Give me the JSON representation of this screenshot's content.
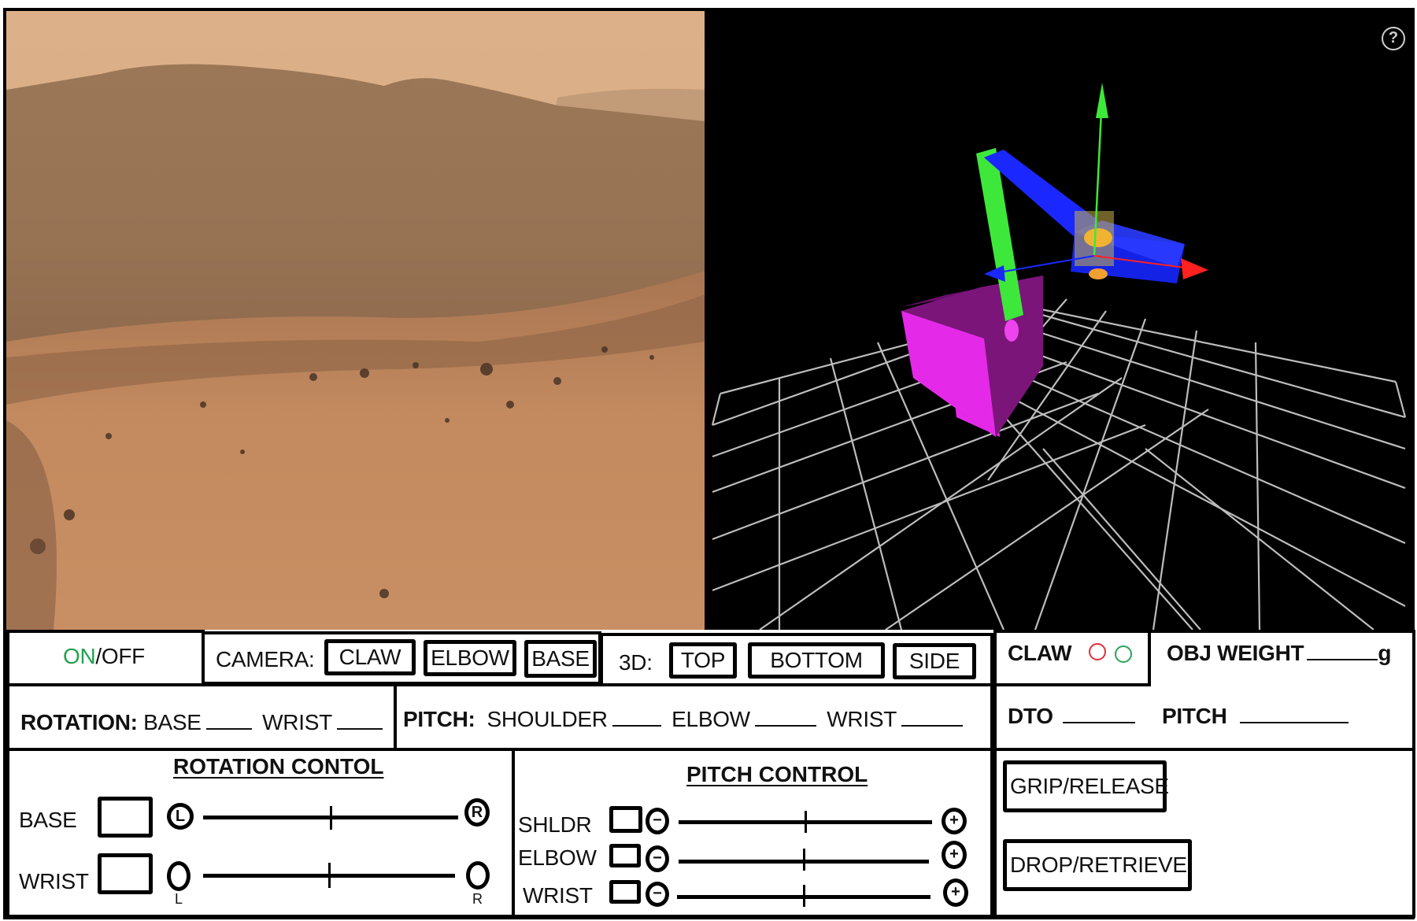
{
  "views": {
    "camera_feed": "mars-terrain-camera",
    "three_d": "robot-arm-3d-model",
    "help_label": "?"
  },
  "toolbar": {
    "power": {
      "on_label": "ON",
      "separator": "/",
      "off_label": "OFF",
      "on_color": "#22a24f"
    },
    "camera": {
      "label": "CAMERA:",
      "buttons": [
        "CLAW",
        "ELBOW",
        "BASE"
      ]
    },
    "view3d": {
      "label": "3D:",
      "buttons": [
        "TOP",
        "BOTTOM",
        "SIDE"
      ]
    }
  },
  "status": {
    "claw": {
      "label": "CLAW",
      "indicator_red": "#e0303a",
      "indicator_green": "#2aa35a"
    },
    "obj_weight": {
      "label": "OBJ WEIGHT",
      "value": "",
      "unit": "g"
    },
    "dto": {
      "label": "DTO",
      "value": ""
    },
    "pitch": {
      "label": "PITCH",
      "value": ""
    }
  },
  "readouts": {
    "rotation": {
      "label": "ROTATION:",
      "base_label": "BASE",
      "base_value": "",
      "wrist_label": "WRIST",
      "wrist_value": ""
    },
    "pitch": {
      "label": "PITCH:",
      "shoulder_label": "SHOULDER",
      "shoulder_value": "",
      "elbow_label": "ELBOW",
      "elbow_value": "",
      "wrist_label": "WRIST",
      "wrist_value": ""
    }
  },
  "rotation_control": {
    "title": "ROTATION CONTOL",
    "rows": [
      {
        "label": "BASE",
        "left_symbol": "L",
        "right_symbol": "R",
        "position": 0.5
      },
      {
        "label": "WRIST",
        "left_symbol": "",
        "right_symbol": "",
        "left_caption": "L",
        "right_caption": "R",
        "position": 0.5
      }
    ]
  },
  "pitch_control": {
    "title": "PITCH CONTROL",
    "rows": [
      {
        "label": "SHLDR",
        "minus": "−",
        "plus": "+",
        "position": 0.5
      },
      {
        "label": "ELBOW",
        "minus": "−",
        "plus": "+",
        "position": 0.5
      },
      {
        "label": "WRIST",
        "minus": "−",
        "plus": "+",
        "position": 0.5
      }
    ]
  },
  "actions": {
    "grip_release": "GRIP/RELEASE",
    "drop_retrieve": "DROP/RETRIEVE"
  }
}
